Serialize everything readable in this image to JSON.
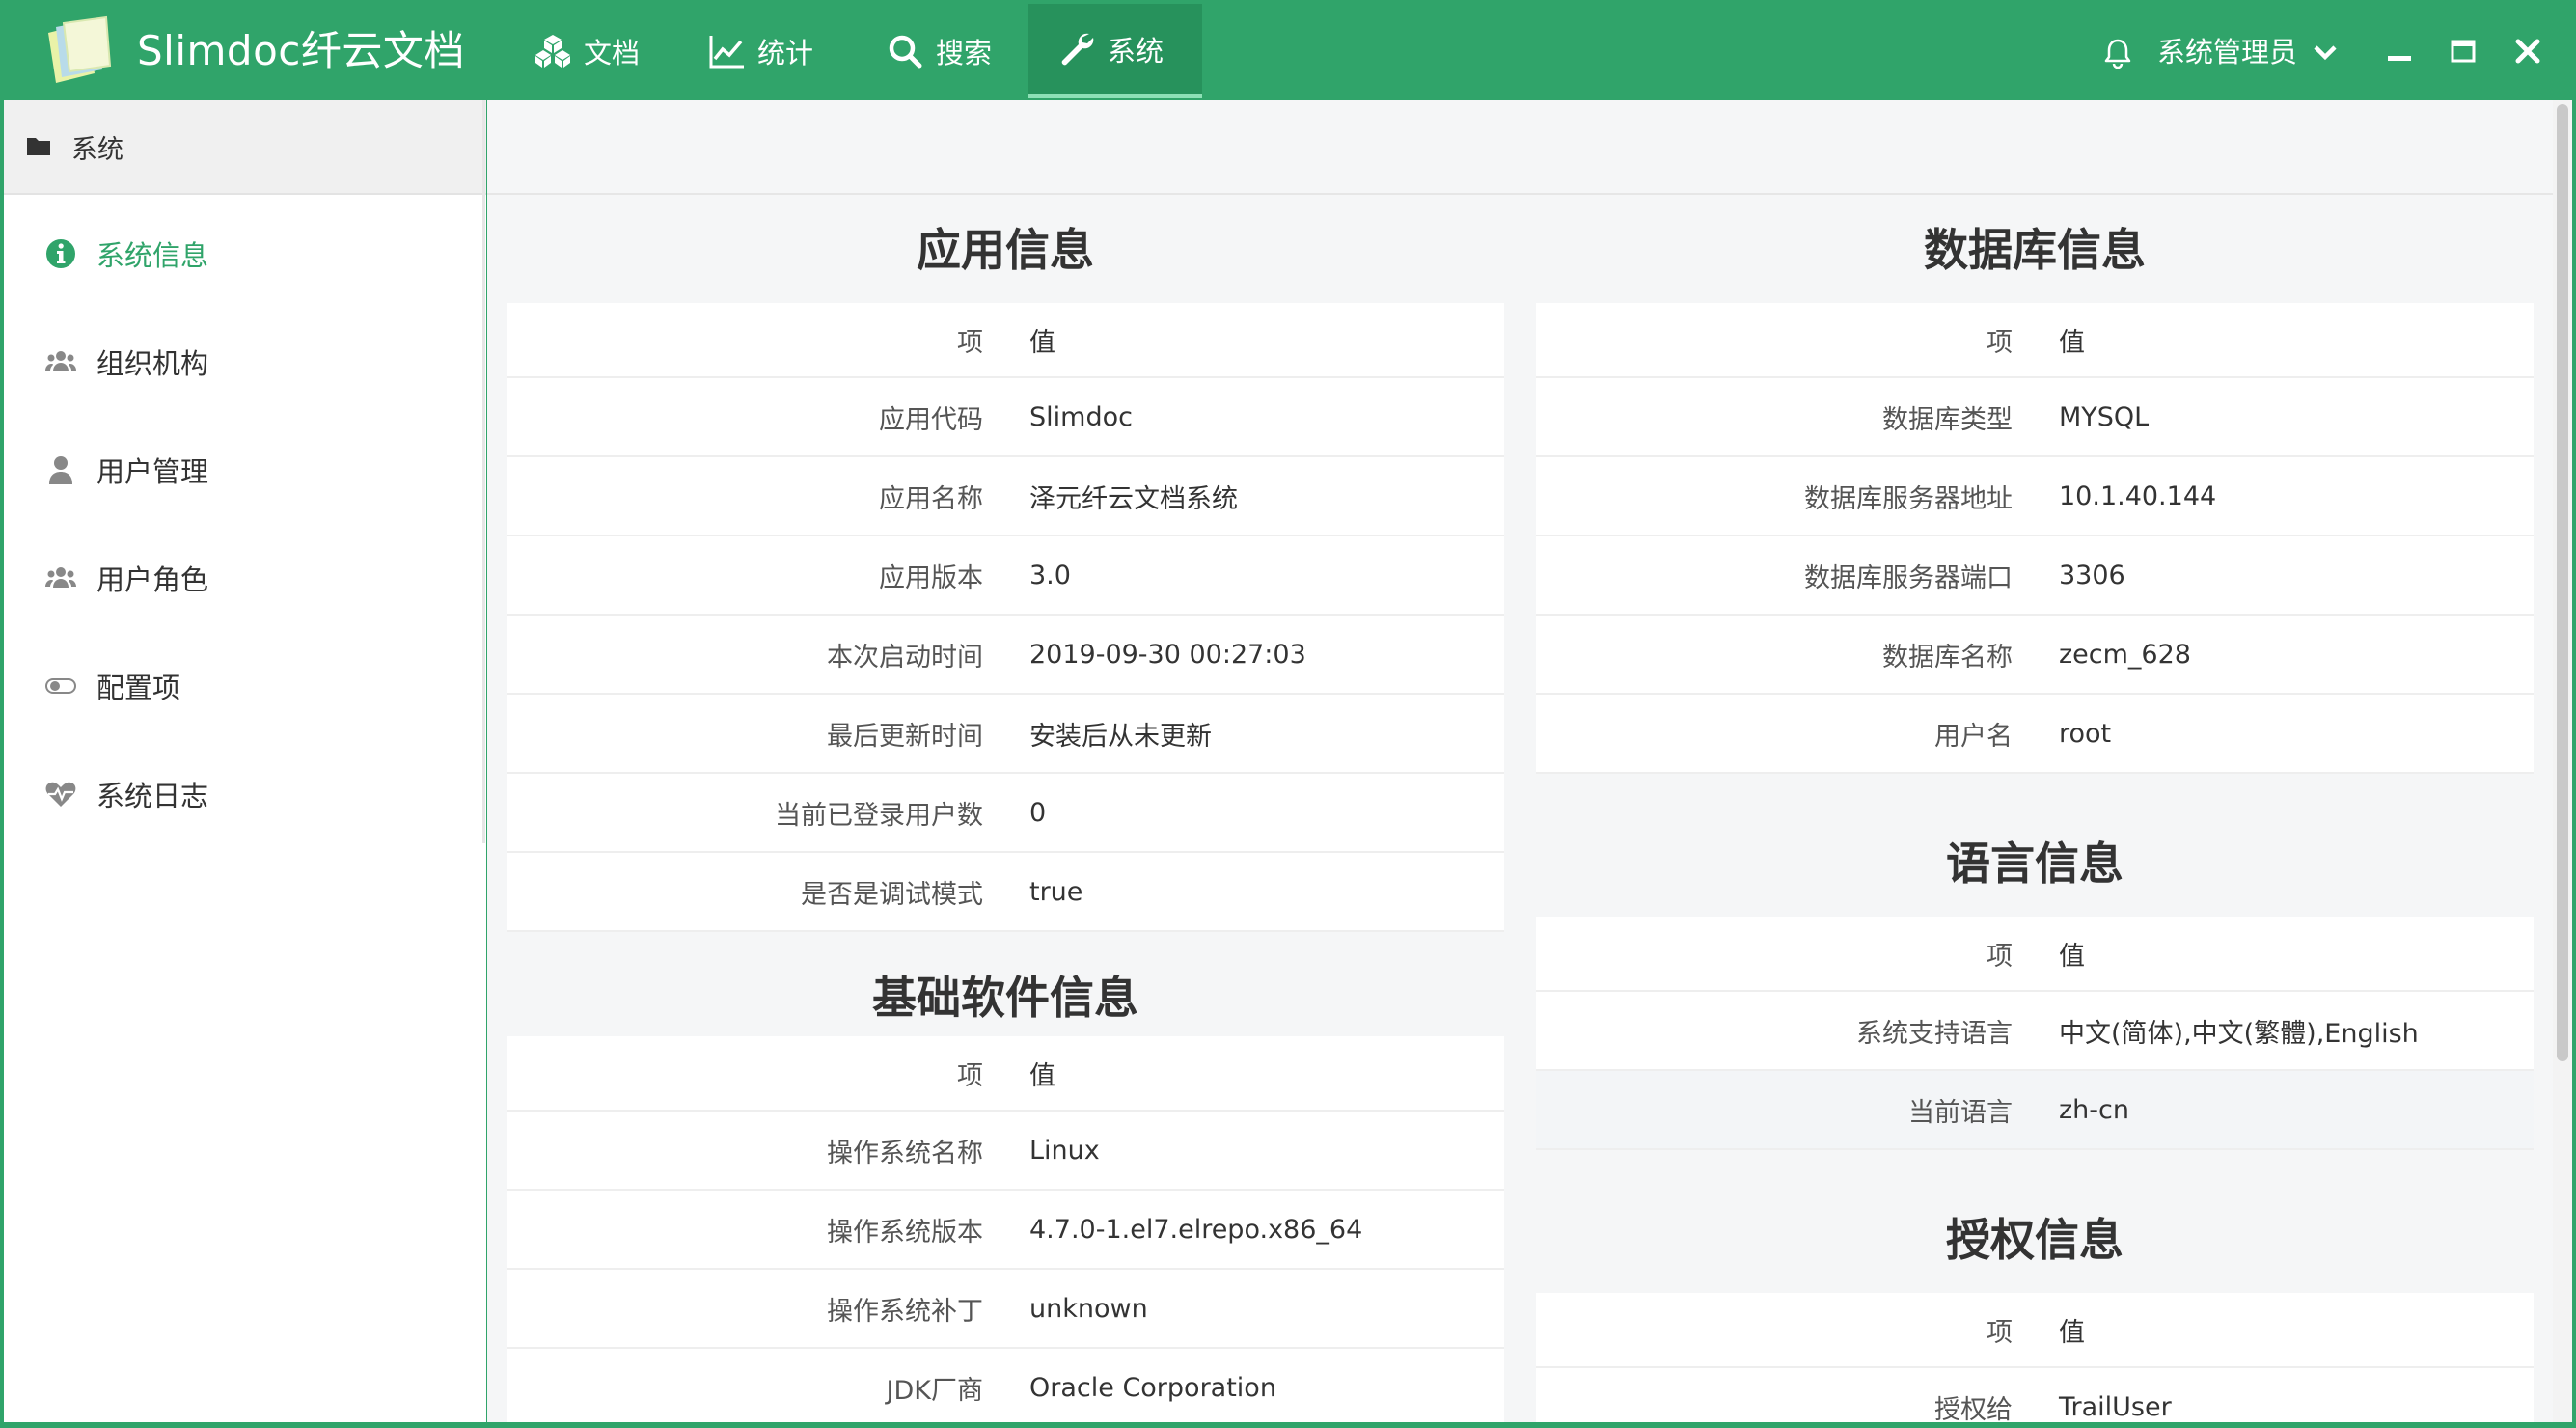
{
  "app": {
    "title": "Slimdoc纤云文档",
    "nav": [
      {
        "label": "文档",
        "icon": "cubes-icon"
      },
      {
        "label": "统计",
        "icon": "line-chart-icon"
      },
      {
        "label": "搜索",
        "icon": "search-icon"
      },
      {
        "label": "系统",
        "icon": "wrench-icon",
        "active": true
      }
    ],
    "user": "系统管理员"
  },
  "sidebar": {
    "header": "系统",
    "items": [
      {
        "label": "系统信息",
        "icon": "info-circle-icon",
        "active": true
      },
      {
        "label": "组织机构",
        "icon": "users-icon"
      },
      {
        "label": "用户管理",
        "icon": "user-icon"
      },
      {
        "label": "用户角色",
        "icon": "users-icon"
      },
      {
        "label": "配置项",
        "icon": "toggle-icon"
      },
      {
        "label": "系统日志",
        "icon": "heartbeat-icon"
      }
    ]
  },
  "table_header": {
    "key": "项",
    "value": "值"
  },
  "app_info": {
    "title": "应用信息",
    "rows": [
      {
        "k": "应用代码",
        "v": "Slimdoc"
      },
      {
        "k": "应用名称",
        "v": "泽元纤云文档系统"
      },
      {
        "k": "应用版本",
        "v": "3.0"
      },
      {
        "k": "本次启动时间",
        "v": "2019-09-30 00:27:03"
      },
      {
        "k": "最后更新时间",
        "v": "安装后从未更新"
      },
      {
        "k": "当前已登录用户数",
        "v": "0"
      },
      {
        "k": "是否是调试模式",
        "v": "true"
      }
    ]
  },
  "software_info": {
    "title": "基础软件信息",
    "rows": [
      {
        "k": "操作系统名称",
        "v": "Linux"
      },
      {
        "k": "操作系统版本",
        "v": "4.7.0-1.el7.elrepo.x86_64"
      },
      {
        "k": "操作系统补丁",
        "v": "unknown"
      },
      {
        "k": "JDK厂商",
        "v": "Oracle Corporation"
      }
    ]
  },
  "db_info": {
    "title": "数据库信息",
    "rows": [
      {
        "k": "数据库类型",
        "v": "MYSQL"
      },
      {
        "k": "数据库服务器地址",
        "v": "10.1.40.144"
      },
      {
        "k": "数据库服务器端口",
        "v": "3306"
      },
      {
        "k": "数据库名称",
        "v": "zecm_628"
      },
      {
        "k": "用户名",
        "v": "root"
      }
    ]
  },
  "lang_info": {
    "title": "语言信息",
    "rows": [
      {
        "k": "系统支持语言",
        "v": "中文(简体),中文(繁體),English"
      },
      {
        "k": "当前语言",
        "v": "zh-cn"
      }
    ]
  },
  "license_info": {
    "title": "授权信息",
    "rows": [
      {
        "k": "授权给",
        "v": "TrailUser"
      }
    ]
  },
  "colors": {
    "brand": "#30a46a",
    "brand_dark": "#27925c",
    "bg": "#f5f6f7"
  }
}
